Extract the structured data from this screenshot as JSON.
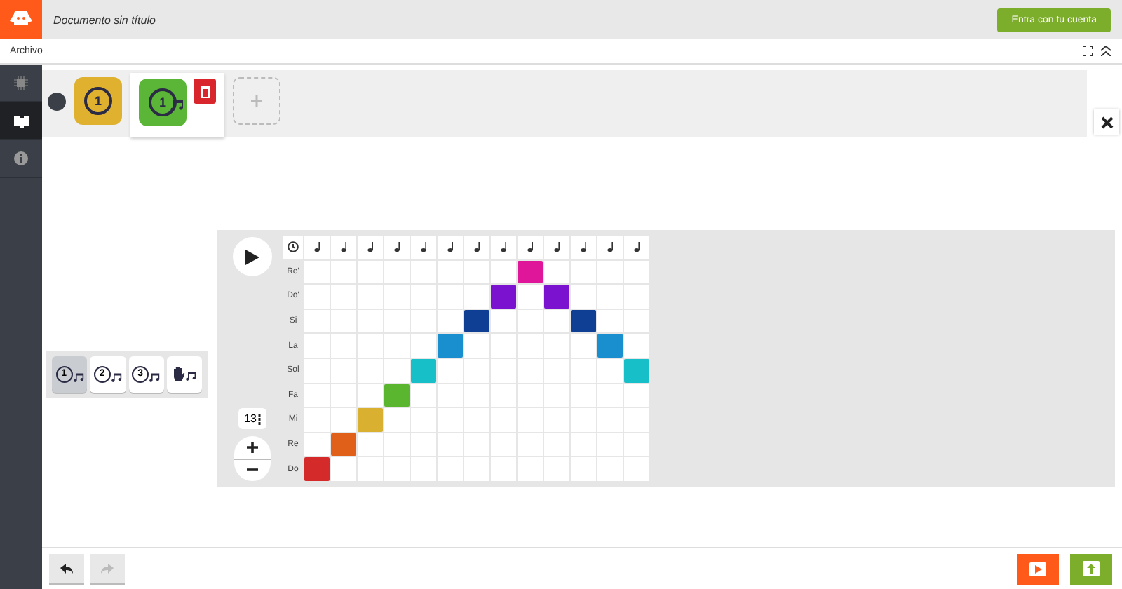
{
  "header": {
    "title": "Documento sin título",
    "login_button": "Entra con tu cuenta"
  },
  "menu": {
    "items": [
      "Archivo"
    ]
  },
  "sidebar": {
    "items": [
      {
        "kind": "chip",
        "selected": false
      },
      {
        "kind": "blocks",
        "selected": true
      },
      {
        "kind": "info",
        "selected": false
      }
    ]
  },
  "blocks": [
    {
      "kind": "loop",
      "label": "1",
      "selected": false
    },
    {
      "kind": "melody",
      "label": "1",
      "selected": true
    }
  ],
  "modes": [
    {
      "kind": "one",
      "label": "1",
      "selected": true
    },
    {
      "kind": "two",
      "label": "2",
      "selected": false
    },
    {
      "kind": "three",
      "label": "3",
      "selected": false
    },
    {
      "kind": "hand",
      "selected": false
    }
  ],
  "tempo": "13",
  "grid": {
    "rows": [
      {
        "label": "Re'",
        "color": "#e0169a",
        "cells": [
          false,
          false,
          false,
          false,
          false,
          false,
          false,
          false,
          true,
          false,
          false,
          false,
          false
        ]
      },
      {
        "label": "Do'",
        "color": "#7a12d0",
        "cells": [
          false,
          false,
          false,
          false,
          false,
          false,
          false,
          true,
          false,
          true,
          false,
          false,
          false
        ]
      },
      {
        "label": "Si",
        "color": "#0f3f94",
        "cells": [
          false,
          false,
          false,
          false,
          false,
          false,
          true,
          false,
          false,
          false,
          true,
          false,
          false
        ]
      },
      {
        "label": "La",
        "color": "#1a8fd0",
        "cells": [
          false,
          false,
          false,
          false,
          false,
          true,
          false,
          false,
          false,
          false,
          false,
          true,
          false
        ]
      },
      {
        "label": "Sol",
        "color": "#17c0c8",
        "cells": [
          false,
          false,
          false,
          false,
          true,
          false,
          false,
          false,
          false,
          false,
          false,
          false,
          true
        ]
      },
      {
        "label": "Fa",
        "color": "#5ab52f",
        "cells": [
          false,
          false,
          false,
          true,
          false,
          false,
          false,
          false,
          false,
          false,
          false,
          false,
          false
        ]
      },
      {
        "label": "Mi",
        "color": "#d9b030",
        "cells": [
          false,
          false,
          true,
          false,
          false,
          false,
          false,
          false,
          false,
          false,
          false,
          false,
          false
        ]
      },
      {
        "label": "Re",
        "color": "#e0601a",
        "cells": [
          false,
          true,
          false,
          false,
          false,
          false,
          false,
          false,
          false,
          false,
          false,
          false,
          false
        ]
      },
      {
        "label": "Do",
        "color": "#d42a2a",
        "cells": [
          true,
          false,
          false,
          false,
          false,
          false,
          false,
          false,
          false,
          false,
          false,
          false,
          false
        ]
      }
    ]
  },
  "footer": {
    "undo_enabled": true,
    "redo_enabled": false
  }
}
